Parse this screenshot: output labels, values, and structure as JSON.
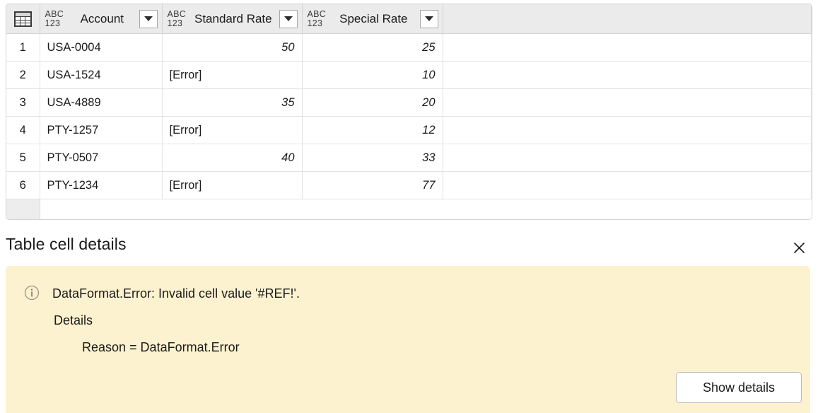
{
  "grid": {
    "corner_icon": "table-icon",
    "type_badge": {
      "top": "ABC",
      "bottom": "123"
    },
    "columns": [
      {
        "label": "Account",
        "type": "ABC123",
        "align": "left"
      },
      {
        "label": "Standard Rate",
        "type": "ABC123",
        "align": "right"
      },
      {
        "label": "Special Rate",
        "type": "ABC123",
        "align": "right"
      }
    ],
    "filter_icon": "chevron-down-icon",
    "rows": [
      {
        "num": "1",
        "account": "USA-0004",
        "standard": "50",
        "special": "25",
        "standard_is_error": false,
        "selected": false
      },
      {
        "num": "2",
        "account": "USA-1524",
        "standard": "[Error]",
        "special": "10",
        "standard_is_error": true,
        "selected": false
      },
      {
        "num": "3",
        "account": "USA-4889",
        "standard": "35",
        "special": "20",
        "standard_is_error": false,
        "selected": false
      },
      {
        "num": "4",
        "account": "PTY-1257",
        "standard": "[Error]",
        "special": "12",
        "standard_is_error": true,
        "selected": true
      },
      {
        "num": "5",
        "account": "PTY-0507",
        "standard": "40",
        "special": "33",
        "standard_is_error": false,
        "selected": false
      },
      {
        "num": "6",
        "account": "PTY-1234",
        "standard": "[Error]",
        "special": "77",
        "standard_is_error": true,
        "selected": false
      }
    ]
  },
  "details": {
    "title": "Table cell details",
    "close_icon": "close-icon",
    "message": {
      "icon": "info-icon",
      "line1": "DataFormat.Error: Invalid cell value '#REF!'.",
      "line2": "Details",
      "line3": "Reason = DataFormat.Error"
    },
    "show_details_label": "Show details"
  },
  "colors": {
    "error_text": "#0f7176",
    "message_bar_bg": "#fdf2cf",
    "header_bg": "#ebebeb",
    "rownum_bg": "#ededed",
    "selected_cell_bg": "#eaeaea"
  }
}
